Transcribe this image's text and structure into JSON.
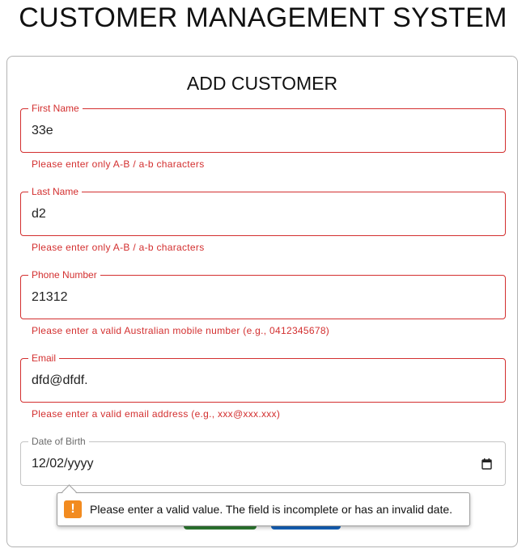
{
  "header": {
    "title": "CUSTOMER MANAGEMENT SYSTEM"
  },
  "form": {
    "title": "ADD CUSTOMER",
    "fields": [
      {
        "label": "First Name",
        "value": "33e",
        "error": "Please enter only A-B / a-b characters"
      },
      {
        "label": "Last Name",
        "value": "d2",
        "error": "Please enter only A-B / a-b characters"
      },
      {
        "label": "Phone Number",
        "value": "21312",
        "error": "Please enter a valid Australian mobile number (e.g., 0412345678)"
      },
      {
        "label": "Email",
        "value": "dfd@dfdf.",
        "error": "Please enter a valid email address (e.g., xxx@xxx.xxx)"
      },
      {
        "label": "Date of Birth",
        "value": "12/02/yyyy",
        "icon": "calendar-icon"
      }
    ]
  },
  "validation_tooltip": {
    "icon": "warning-icon",
    "message": "Please enter a valid value. The field is incomplete or has an invalid date."
  },
  "colors": {
    "error": "#d32f2f",
    "primary_button": "#2e7d32",
    "secondary_button": "#1565c0",
    "warning": "#f28b20"
  }
}
